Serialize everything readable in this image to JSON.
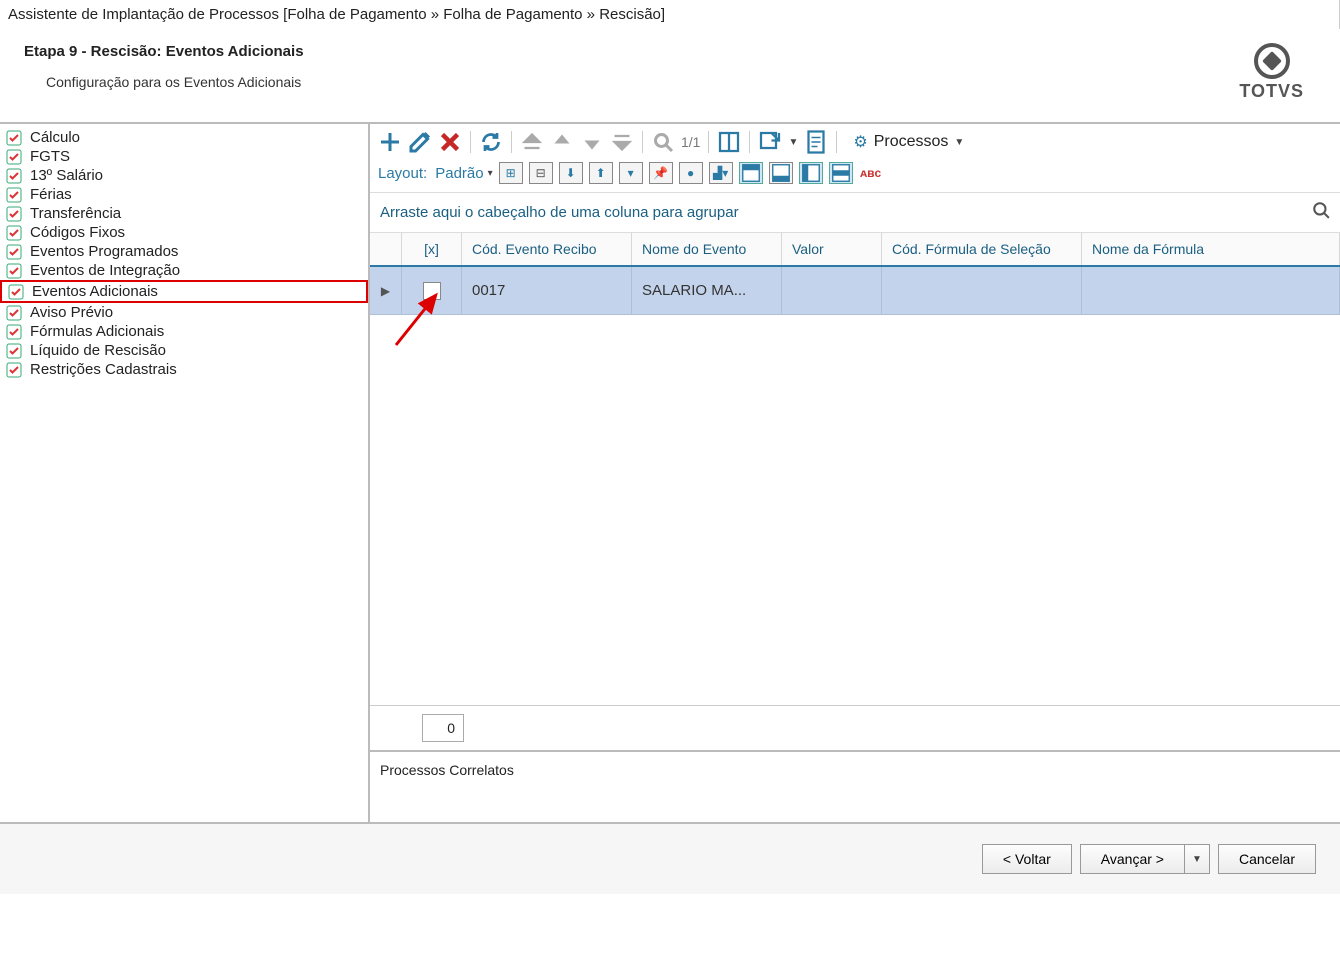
{
  "window": {
    "title": "Assistente de Implantação de Processos [Folha de Pagamento » Folha de Pagamento » Rescisão]"
  },
  "header": {
    "stage_title": "Etapa 9 - Rescisão: Eventos Adicionais",
    "stage_desc": "Configuração para os Eventos Adicionais",
    "brand": "TOTVS"
  },
  "sidebar": {
    "items": [
      {
        "label": "Cálculo",
        "highlighted": false
      },
      {
        "label": "FGTS",
        "highlighted": false
      },
      {
        "label": "13º Salário",
        "highlighted": false
      },
      {
        "label": "Férias",
        "highlighted": false
      },
      {
        "label": "Transferência",
        "highlighted": false
      },
      {
        "label": "Códigos Fixos",
        "highlighted": false
      },
      {
        "label": "Eventos Programados",
        "highlighted": false
      },
      {
        "label": "Eventos de Integração",
        "highlighted": false
      },
      {
        "label": "Eventos Adicionais",
        "highlighted": true
      },
      {
        "label": "Aviso Prévio",
        "highlighted": false
      },
      {
        "label": "Fórmulas Adicionais",
        "highlighted": false
      },
      {
        "label": "Líquido de Rescisão",
        "highlighted": false
      },
      {
        "label": "Restrições Cadastrais",
        "highlighted": false
      }
    ]
  },
  "toolbar": {
    "page": "1/1",
    "processes_label": "Processos",
    "layout_label": "Layout:",
    "layout_value": "Padrão"
  },
  "grid": {
    "group_hint": "Arraste aqui o cabeçalho de uma coluna para agrupar",
    "columns": {
      "check": "[x]",
      "code": "Cód. Evento Recibo",
      "name": "Nome do Evento",
      "valor": "Valor",
      "formula": "Cód. Fórmula de Seleção",
      "fname": "Nome da Fórmula"
    },
    "rows": [
      {
        "checked": false,
        "code": "0017",
        "name": "SALARIO MA...",
        "valor": "",
        "formula": "",
        "fname": ""
      }
    ],
    "footer_count": "0"
  },
  "correlatos": {
    "title": "Processos Correlatos"
  },
  "wizard": {
    "back": "< Voltar",
    "next": "Avançar >",
    "cancel": "Cancelar"
  }
}
